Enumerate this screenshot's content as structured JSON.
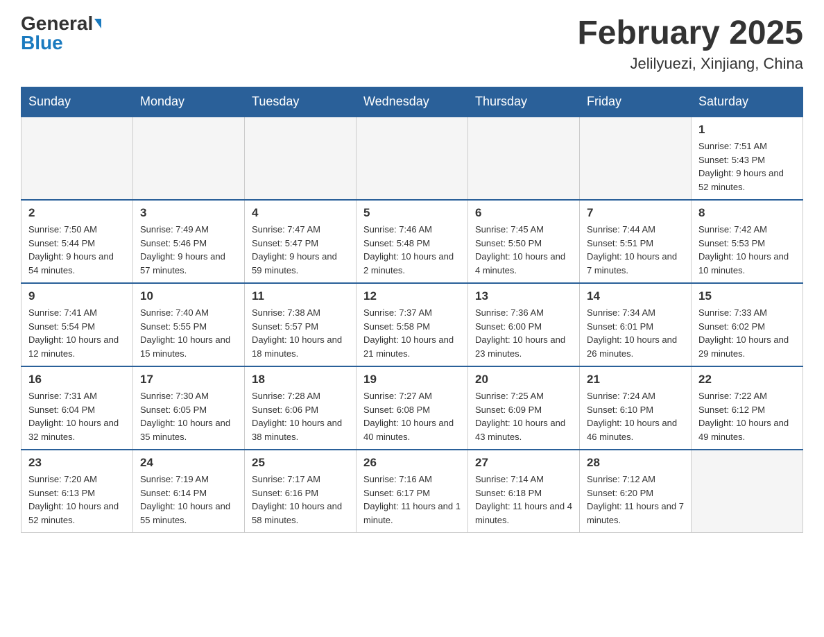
{
  "header": {
    "logo_general": "General",
    "logo_blue": "Blue",
    "month_title": "February 2025",
    "location": "Jelilyuezi, Xinjiang, China"
  },
  "weekdays": [
    "Sunday",
    "Monday",
    "Tuesday",
    "Wednesday",
    "Thursday",
    "Friday",
    "Saturday"
  ],
  "weeks": [
    [
      {
        "day": "",
        "info": ""
      },
      {
        "day": "",
        "info": ""
      },
      {
        "day": "",
        "info": ""
      },
      {
        "day": "",
        "info": ""
      },
      {
        "day": "",
        "info": ""
      },
      {
        "day": "",
        "info": ""
      },
      {
        "day": "1",
        "info": "Sunrise: 7:51 AM\nSunset: 5:43 PM\nDaylight: 9 hours and 52 minutes."
      }
    ],
    [
      {
        "day": "2",
        "info": "Sunrise: 7:50 AM\nSunset: 5:44 PM\nDaylight: 9 hours and 54 minutes."
      },
      {
        "day": "3",
        "info": "Sunrise: 7:49 AM\nSunset: 5:46 PM\nDaylight: 9 hours and 57 minutes."
      },
      {
        "day": "4",
        "info": "Sunrise: 7:47 AM\nSunset: 5:47 PM\nDaylight: 9 hours and 59 minutes."
      },
      {
        "day": "5",
        "info": "Sunrise: 7:46 AM\nSunset: 5:48 PM\nDaylight: 10 hours and 2 minutes."
      },
      {
        "day": "6",
        "info": "Sunrise: 7:45 AM\nSunset: 5:50 PM\nDaylight: 10 hours and 4 minutes."
      },
      {
        "day": "7",
        "info": "Sunrise: 7:44 AM\nSunset: 5:51 PM\nDaylight: 10 hours and 7 minutes."
      },
      {
        "day": "8",
        "info": "Sunrise: 7:42 AM\nSunset: 5:53 PM\nDaylight: 10 hours and 10 minutes."
      }
    ],
    [
      {
        "day": "9",
        "info": "Sunrise: 7:41 AM\nSunset: 5:54 PM\nDaylight: 10 hours and 12 minutes."
      },
      {
        "day": "10",
        "info": "Sunrise: 7:40 AM\nSunset: 5:55 PM\nDaylight: 10 hours and 15 minutes."
      },
      {
        "day": "11",
        "info": "Sunrise: 7:38 AM\nSunset: 5:57 PM\nDaylight: 10 hours and 18 minutes."
      },
      {
        "day": "12",
        "info": "Sunrise: 7:37 AM\nSunset: 5:58 PM\nDaylight: 10 hours and 21 minutes."
      },
      {
        "day": "13",
        "info": "Sunrise: 7:36 AM\nSunset: 6:00 PM\nDaylight: 10 hours and 23 minutes."
      },
      {
        "day": "14",
        "info": "Sunrise: 7:34 AM\nSunset: 6:01 PM\nDaylight: 10 hours and 26 minutes."
      },
      {
        "day": "15",
        "info": "Sunrise: 7:33 AM\nSunset: 6:02 PM\nDaylight: 10 hours and 29 minutes."
      }
    ],
    [
      {
        "day": "16",
        "info": "Sunrise: 7:31 AM\nSunset: 6:04 PM\nDaylight: 10 hours and 32 minutes."
      },
      {
        "day": "17",
        "info": "Sunrise: 7:30 AM\nSunset: 6:05 PM\nDaylight: 10 hours and 35 minutes."
      },
      {
        "day": "18",
        "info": "Sunrise: 7:28 AM\nSunset: 6:06 PM\nDaylight: 10 hours and 38 minutes."
      },
      {
        "day": "19",
        "info": "Sunrise: 7:27 AM\nSunset: 6:08 PM\nDaylight: 10 hours and 40 minutes."
      },
      {
        "day": "20",
        "info": "Sunrise: 7:25 AM\nSunset: 6:09 PM\nDaylight: 10 hours and 43 minutes."
      },
      {
        "day": "21",
        "info": "Sunrise: 7:24 AM\nSunset: 6:10 PM\nDaylight: 10 hours and 46 minutes."
      },
      {
        "day": "22",
        "info": "Sunrise: 7:22 AM\nSunset: 6:12 PM\nDaylight: 10 hours and 49 minutes."
      }
    ],
    [
      {
        "day": "23",
        "info": "Sunrise: 7:20 AM\nSunset: 6:13 PM\nDaylight: 10 hours and 52 minutes."
      },
      {
        "day": "24",
        "info": "Sunrise: 7:19 AM\nSunset: 6:14 PM\nDaylight: 10 hours and 55 minutes."
      },
      {
        "day": "25",
        "info": "Sunrise: 7:17 AM\nSunset: 6:16 PM\nDaylight: 10 hours and 58 minutes."
      },
      {
        "day": "26",
        "info": "Sunrise: 7:16 AM\nSunset: 6:17 PM\nDaylight: 11 hours and 1 minute."
      },
      {
        "day": "27",
        "info": "Sunrise: 7:14 AM\nSunset: 6:18 PM\nDaylight: 11 hours and 4 minutes."
      },
      {
        "day": "28",
        "info": "Sunrise: 7:12 AM\nSunset: 6:20 PM\nDaylight: 11 hours and 7 minutes."
      },
      {
        "day": "",
        "info": ""
      }
    ]
  ]
}
